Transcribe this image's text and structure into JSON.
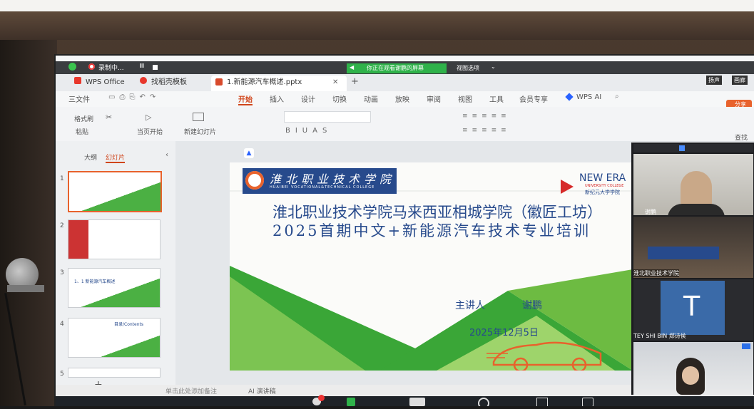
{
  "recording": {
    "label": "录制中...",
    "pause": "II"
  },
  "sharing_banner": {
    "text": "你正在观看谢鹏的屏幕",
    "options": "视图选项"
  },
  "top_right": {
    "speaker": "扬声",
    "gallery": "画廊"
  },
  "tabs": [
    {
      "label": "WPS Office"
    },
    {
      "label": "找稻壳模板"
    },
    {
      "label": "1.新能源汽车概述.pptx"
    }
  ],
  "menu": {
    "file": "三文件",
    "items": [
      "开始",
      "插入",
      "设计",
      "切换",
      "动画",
      "放映",
      "审阅",
      "视图",
      "工具",
      "会员专享"
    ],
    "wps_ai": "WPS AI",
    "share": "分享"
  },
  "ribbon": {
    "format_painter": "格式刷",
    "paste": "粘贴",
    "from_current": "当页开始",
    "new_slide": "新建幻灯片",
    "find": "查找"
  },
  "side_panel": {
    "tabs": [
      "大纲",
      "幻灯片"
    ],
    "slide_numbers": [
      "1",
      "2",
      "3",
      "4",
      "5"
    ],
    "thumb3_text": "1、1 新能源汽车概述",
    "thumb4_text": "目录/Contents",
    "add": "+"
  },
  "slide": {
    "logo_cn": "淮北职业技术学院",
    "logo_en": "HUAIBEI VOCATIONAL&TECHNICAL COLLEGE",
    "new_era": "NEW ERA",
    "new_era_sub1": "UNIVERSITY COLLEGE",
    "new_era_sub2": "新纪元大学学院",
    "title_line1": "淮北职业技术学院马来西亚相城学院（徽匠工坊）",
    "title_line2": "2025首期中文+新能源汽车技术专业培训",
    "presenter_label": "主讲人",
    "presenter_name": "谢鹏",
    "date": "2025年12月5日"
  },
  "status": {
    "notes": "单击此处添加备注",
    "ai_script": "AI 演讲稿"
  },
  "video": {
    "tile1_name": "谢鹏",
    "tile2_name": "淮北职业技术学院",
    "tile3_letter": "T",
    "tile3_name": "TEY SHI BIN 郑诗侯"
  },
  "colors": {
    "accent_orange": "#e8622c",
    "banner_green": "#2fb24a",
    "slide_green": "#3aa637",
    "title_blue": "#274a8c"
  }
}
